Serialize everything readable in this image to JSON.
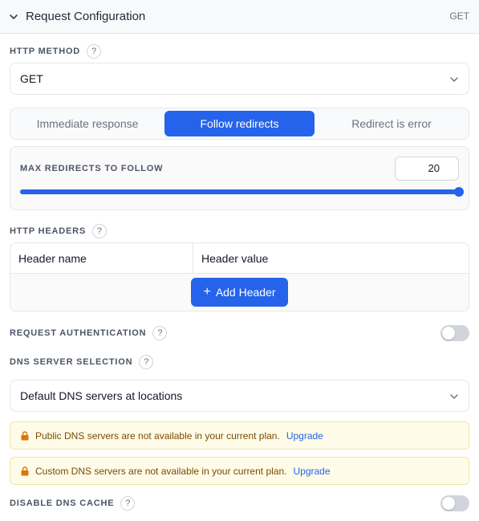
{
  "header": {
    "title": "Request Configuration",
    "method_badge": "GET"
  },
  "http_method": {
    "label": "HTTP METHOD",
    "help": "?",
    "value": "GET"
  },
  "redirect_mode": {
    "options": [
      "Immediate response",
      "Follow redirects",
      "Redirect is error"
    ],
    "selected": "Follow redirects"
  },
  "max_redirects": {
    "label": "MAX REDIRECTS TO FOLLOW",
    "value": "20",
    "slider_fraction": 1.0
  },
  "http_headers": {
    "label": "HTTP HEADERS",
    "help": "?",
    "col_name": "Header name",
    "col_value": "Header value",
    "add_label": "Add Header",
    "add_icon": "+"
  },
  "request_auth": {
    "label": "REQUEST AUTHENTICATION",
    "help": "?",
    "enabled": false
  },
  "dns_selection": {
    "label": "DNS SERVER SELECTION",
    "help": "?",
    "value": "Default DNS servers at locations"
  },
  "notices": [
    {
      "text": "Public DNS servers are not available in your current plan.",
      "link": "Upgrade"
    },
    {
      "text": "Custom DNS servers are not available in your current plan.",
      "link": "Upgrade"
    }
  ],
  "dns_cache": {
    "label": "DISABLE DNS CACHE",
    "help": "?",
    "enabled": false
  },
  "icons": {
    "collapse": "chevron-down-icon",
    "select_arrow": "chevron-down-icon",
    "lock": "lock-icon",
    "help": "question-icon"
  },
  "colors": {
    "accent": "#2563eb",
    "notice_bg": "#fefce8",
    "notice_text": "#7c4a03",
    "lock": "#d97706"
  }
}
